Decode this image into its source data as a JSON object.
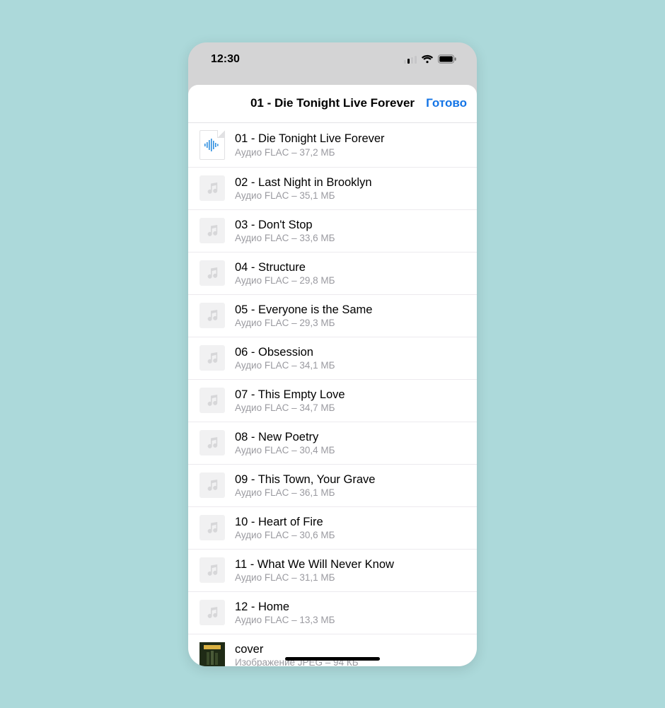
{
  "status": {
    "time": "12:30"
  },
  "header": {
    "title": "01 - Die Tonight Live Forever",
    "done": "Готово"
  },
  "files": [
    {
      "kind": "audio-doc",
      "title": "01 - Die Tonight Live Forever",
      "meta": "Аудио FLAC – 37,2 МБ"
    },
    {
      "kind": "audio",
      "title": "02 - Last Night in Brooklyn",
      "meta": "Аудио FLAC – 35,1 МБ"
    },
    {
      "kind": "audio",
      "title": "03 - Don't Stop",
      "meta": "Аудио FLAC – 33,6 МБ"
    },
    {
      "kind": "audio",
      "title": "04 - Structure",
      "meta": "Аудио FLAC – 29,8 МБ"
    },
    {
      "kind": "audio",
      "title": "05 - Everyone is the Same",
      "meta": "Аудио FLAC – 29,3 МБ"
    },
    {
      "kind": "audio",
      "title": "06 - Obsession",
      "meta": "Аудио FLAC – 34,1 МБ"
    },
    {
      "kind": "audio",
      "title": "07 - This Empty Love",
      "meta": "Аудио FLAC – 34,7 МБ"
    },
    {
      "kind": "audio",
      "title": "08 - New Poetry",
      "meta": "Аудио FLAC – 30,4 МБ"
    },
    {
      "kind": "audio",
      "title": "09 - This Town, Your Grave",
      "meta": "Аудио FLAC – 36,1 МБ"
    },
    {
      "kind": "audio",
      "title": "10 - Heart of Fire",
      "meta": "Аудио FLAC – 30,6 МБ"
    },
    {
      "kind": "audio",
      "title": "11 - What We Will Never Know",
      "meta": "Аудио FLAC – 31,1 МБ"
    },
    {
      "kind": "audio",
      "title": "12 - Home",
      "meta": "Аудио FLAC – 13,3 МБ"
    },
    {
      "kind": "image",
      "title": "cover",
      "meta": "Изображение JPEG – 94 КБ"
    }
  ]
}
